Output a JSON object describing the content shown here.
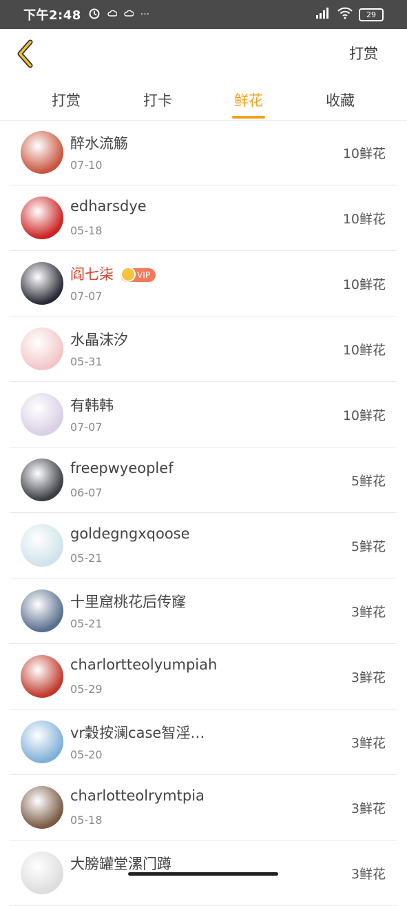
{
  "status_bar": {
    "time": "下午2:48",
    "dots": "···",
    "battery": "29"
  },
  "header": {
    "action": "打赏"
  },
  "tabs": [
    {
      "label": "打赏",
      "active": false
    },
    {
      "label": "打卡",
      "active": false
    },
    {
      "label": "鲜花",
      "active": true
    },
    {
      "label": "收藏",
      "active": false
    }
  ],
  "items": [
    {
      "name": "醉水流觞",
      "date": "07-10",
      "amount": "10鲜花",
      "avatar_color": "#c9553e"
    },
    {
      "name": "edharsdye",
      "date": "05-18",
      "amount": "10鲜花",
      "avatar_color": "#cc2222"
    },
    {
      "name": "阎七柒",
      "date": "07-07",
      "amount": "10鲜花",
      "vip": true,
      "vip_label": "VIP",
      "avatar_color": "#2a2a36"
    },
    {
      "name": "水晶沫汐",
      "date": "05-31",
      "amount": "10鲜花",
      "avatar_color": "#f2c6c8"
    },
    {
      "name": "有韩韩",
      "date": "07-07",
      "amount": "10鲜花",
      "avatar_color": "#d8d0e6"
    },
    {
      "name": "freepwyeoplef",
      "date": "06-07",
      "amount": "5鲜花",
      "avatar_color": "#3a3d44"
    },
    {
      "name": "goldegngxqoose",
      "date": "05-21",
      "amount": "5鲜花",
      "avatar_color": "#cfe3ea"
    },
    {
      "name": "十里窟桃花后传窿",
      "date": "05-21",
      "amount": "3鲜花",
      "avatar_color": "#5a6f8e"
    },
    {
      "name": "charlortteolyumpiah",
      "date": "05-29",
      "amount": "3鲜花",
      "avatar_color": "#c0392b"
    },
    {
      "name": "vr穀按澜case智淫…",
      "date": "05-20",
      "amount": "3鲜花",
      "avatar_color": "#7fb0d8"
    },
    {
      "name": "charlotteolrymtpia",
      "date": "05-18",
      "amount": "3鲜花",
      "avatar_color": "#7a5a44"
    },
    {
      "name": "大膀罐堂漯门蹲",
      "date": "",
      "amount": "3鲜花",
      "avatar_color": "#dddddd"
    }
  ],
  "colors": {
    "accent": "#f0a020",
    "vip_name": "#d0452c",
    "vip_badge": "#f07a5a"
  },
  "icons": {
    "back": "chevron-left-icon",
    "alarm": "alarm-icon",
    "wifi": "wifi-icon",
    "signal": "signal-icon",
    "battery": "battery-icon"
  }
}
